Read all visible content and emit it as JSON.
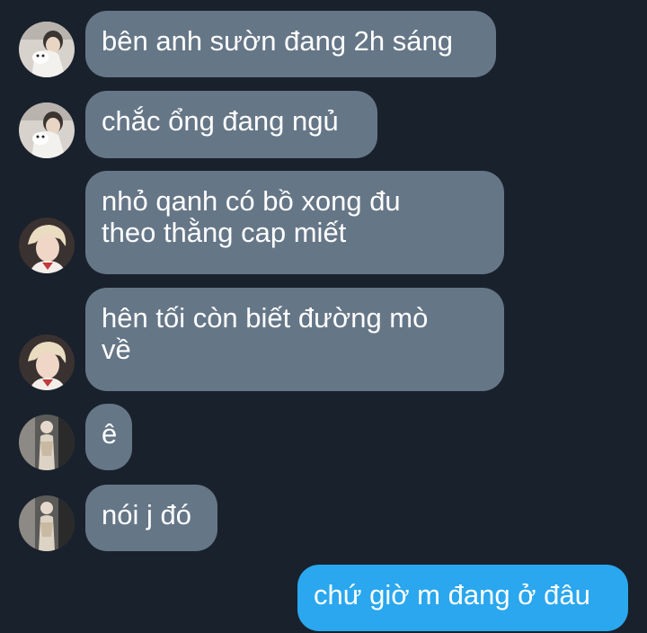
{
  "messages": [
    {
      "text": "bên anh sườn đang 2h sáng"
    },
    {
      "text": "chắc ổng đang ngủ"
    },
    {
      "text": "nhỏ qanh có bồ xong đu\ntheo thằng cap miết"
    },
    {
      "text": "hên tối còn biết đường mò\nvề"
    },
    {
      "text": "ê"
    },
    {
      "text": "nói j đó"
    },
    {
      "text": "chứ giờ m đang ở đâu"
    }
  ],
  "colors": {
    "background": "#19212c",
    "incoming_bubble": "#657687",
    "outgoing_bubble": "#2aa7ee",
    "text": "#ffffff"
  }
}
